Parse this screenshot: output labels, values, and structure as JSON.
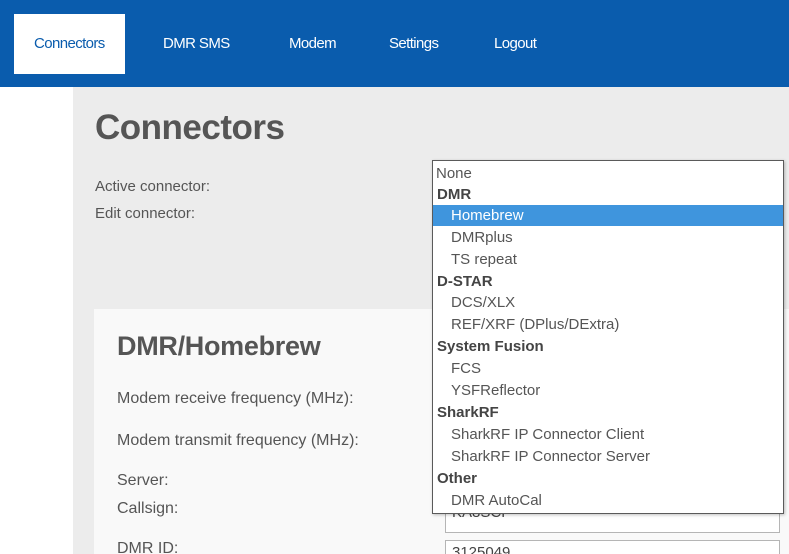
{
  "nav": {
    "tabs": [
      "Connectors",
      "DMR SMS",
      "Modem",
      "Settings",
      "Logout"
    ],
    "active": "Connectors"
  },
  "page": {
    "title": "Connectors",
    "active_connector_label": "Active connector:",
    "edit_connector_label": "Edit connector:"
  },
  "connector_dropdown": {
    "selected": "Homebrew",
    "none_option": "None",
    "groups": [
      {
        "label": "DMR",
        "options": [
          "Homebrew",
          "DMRplus",
          "TS repeat"
        ]
      },
      {
        "label": "D-STAR",
        "options": [
          "DCS/XLX",
          "REF/XRF (DPlus/DExtra)"
        ]
      },
      {
        "label": "System Fusion",
        "options": [
          "FCS",
          "YSFReflector"
        ]
      },
      {
        "label": "SharkRF",
        "options": [
          "SharkRF IP Connector Client",
          "SharkRF IP Connector Server"
        ]
      },
      {
        "label": "Other",
        "options": [
          "DMR AutoCal"
        ]
      }
    ]
  },
  "card": {
    "title": "DMR/Homebrew",
    "fields": {
      "rx_freq_label": "Modem receive frequency (MHz):",
      "tx_freq_label": "Modem transmit frequency (MHz):",
      "server_label": "Server:",
      "callsign_label": "Callsign:",
      "callsign_value": "KA8SCP",
      "dmr_id_label": "DMR ID:",
      "dmr_id_value": "3125049"
    }
  },
  "colors": {
    "brand_blue": "#0a5cad",
    "selection_blue": "#3f95dd"
  }
}
